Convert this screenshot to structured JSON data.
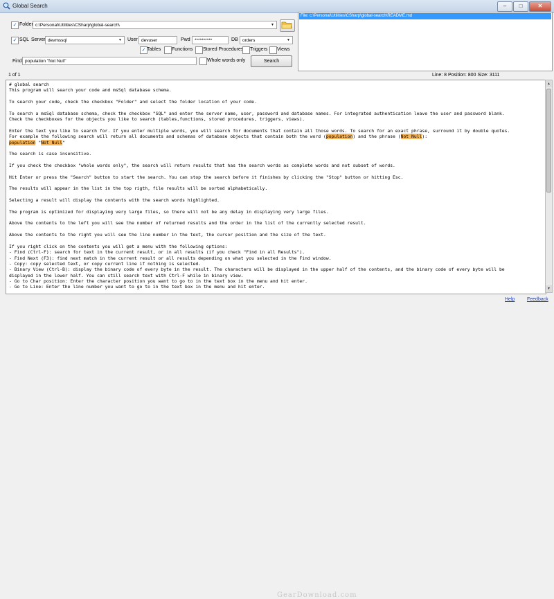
{
  "window": {
    "title": "Global Search"
  },
  "folder": {
    "label": "Folder",
    "checked": true,
    "path": "c:\\Personal\\Utilities\\CSharp\\global-search\\"
  },
  "sql": {
    "label": "SQL",
    "checked": true,
    "server_label": "Server",
    "server": "devmssql",
    "user_label": "User",
    "user": "devuser",
    "pwd_label": "Pwd",
    "pwd": "**********",
    "db_label": "DB",
    "db": "orders",
    "objects": [
      {
        "label": "Tables",
        "checked": true
      },
      {
        "label": "Functions",
        "checked": false
      },
      {
        "label": "Stored Procedures",
        "checked": false
      },
      {
        "label": "Triggers",
        "checked": false
      },
      {
        "label": "Views",
        "checked": false
      }
    ]
  },
  "find": {
    "label": "Find",
    "value": "population \"Not Null\"",
    "whole_words_label": "Whole words only",
    "search_label": "Search"
  },
  "results": {
    "items": [
      "File: c:\\Personal\\Utilities\\CSharp\\global-search\\README.md"
    ]
  },
  "status": {
    "count": "1 of 1",
    "position": "Line: 8  Position: 800  Size: 3111"
  },
  "content": {
    "lines": [
      "# global search",
      "This program will search your code and msSql database schema.",
      "",
      "To search your code, check the checkbox \"Folder\" and select the folder location of your code.",
      "",
      "To search a msSql database schema, check the checkbox \"SQL\" and enter the server name, user, password and database names. For integrated authentication leave the user and password blank.",
      "Check the checkboxes for the objects you like to search (tables,functions, stored procedures, triggers, views).",
      "",
      "Enter the text you like to search for. If you enter multiple words, you will search for documents that contain all those words. To search for an exact phrase, surround it by double quotes.",
      "For example the following search will return all documents and schemas of database objects that contain both the word (population) and the phrase (Not Null):",
      "population \"Not Null\"",
      "",
      "The search is case insensitive.",
      "",
      "If you check the checkbox \"whole words only\", the search will return results that has the search words as complete words and not subset of words.",
      "",
      "Hit Enter or press the \"Search\" button to start the search. You can stop the search before it finishes by clicking the \"Stop\" button or hitting Esc.",
      "",
      "The results will appear in the list in the top rigth, file results will be sorted alphabetically.",
      "",
      "Selecting a result will display the contents with the search words highlighted.",
      "",
      "The program is optimized for displaying very large files, so there will not be any delay in displaying very large files.",
      "",
      "Above the contents to the left you will see the number of returned results and the order in the list of the currently selected result.",
      "",
      "Above the contents to the right you will see the line number in the text, the cursor position and the size of the text.",
      "",
      "If you right click on the contents you will get a menu with the following options:",
      "- Find (Ctrl-F): search for text in the current result, or in all results (if you check \"Find in all Results\").",
      "- Find Next (F3): find next match in the current result or all results depending on what you selected in the Find window.",
      "- Copy: copy selected text, or copy current line if nothing is selected.",
      "- Binary View (Ctrl-B): display the binary code of every byte in the result. The characters will be displayed in the upper half of the contents, and the binary code of every byte will be",
      "displayed in the lower half. You can still search text with Ctrl-F while in binary view.",
      "- Go to Char position: Enter the character position you want to go to in the text box in the menu and hit enter.",
      "- Go to Line: Enter the line number you want to go to in the text box in the menu and hit enter."
    ],
    "line9_pre": "For example the following search will return all documents and schemas of database objects that contain both the word (",
    "line9_hl1": "population",
    "line9_mid": ") and the phrase (",
    "line9_hl2": "Not Null",
    "line9_post": "):",
    "line10_hl1": "population",
    "line10_mid": " \"",
    "line10_hl2": "Not Null",
    "line10_post": "\""
  },
  "footer": {
    "help": "Help",
    "feedback": "Feedback",
    "watermark": "GearDownload.com"
  },
  "colors": {
    "highlight": "#f6b55a",
    "selection": "#3399ff",
    "link": "#1a3fbf"
  }
}
